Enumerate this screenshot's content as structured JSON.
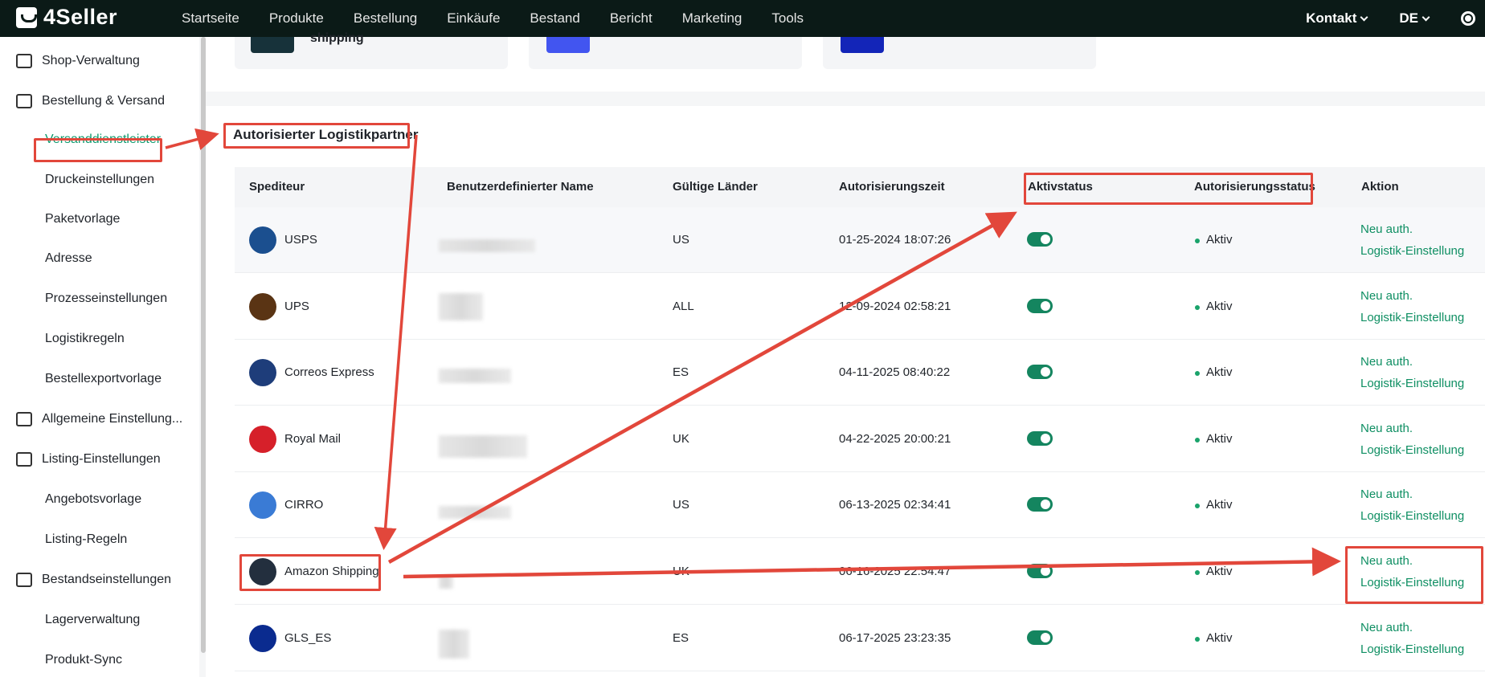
{
  "brand": {
    "name": "4Seller"
  },
  "nav": [
    "Startseite",
    "Produkte",
    "Bestellung",
    "Einkäufe",
    "Bestand",
    "Bericht",
    "Marketing",
    "Tools"
  ],
  "header_right": {
    "contact": "Kontakt",
    "language": "DE"
  },
  "sidebar": {
    "items": [
      {
        "label": "Shop-Verwaltung",
        "level": "top"
      },
      {
        "label": "Bestellung & Versand",
        "level": "top"
      },
      {
        "label": "Versanddienstleister",
        "level": "sub",
        "active": true
      },
      {
        "label": "Druckeinstellungen",
        "level": "sub"
      },
      {
        "label": "Paketvorlage",
        "level": "sub"
      },
      {
        "label": "Adresse",
        "level": "sub"
      },
      {
        "label": "Prozesseinstellungen",
        "level": "sub"
      },
      {
        "label": "Logistikregeln",
        "level": "sub"
      },
      {
        "label": "Bestellexportvorlage",
        "level": "sub"
      },
      {
        "label": "Allgemeine Einstellung...",
        "level": "top"
      },
      {
        "label": "Listing-Einstellungen",
        "level": "top"
      },
      {
        "label": "Angebotsvorlage",
        "level": "sub"
      },
      {
        "label": "Listing-Regeln",
        "level": "sub"
      },
      {
        "label": "Bestandseinstellungen",
        "level": "top"
      },
      {
        "label": "Lagerverwaltung",
        "level": "sub"
      },
      {
        "label": "Produkt-Sync",
        "level": "sub"
      }
    ]
  },
  "top_cards": [
    {
      "text": "shipping"
    }
  ],
  "section": {
    "title": "Autorisierter Logistikpartner"
  },
  "table": {
    "headers": [
      "Spediteur",
      "Benutzerdefinierter Name",
      "Gültige Länder",
      "Autorisierungszeit",
      "Aktivstatus",
      "Autorisierungsstatus",
      "Aktion"
    ],
    "rows": [
      {
        "carrier": "USPS",
        "country": "US",
        "time": "01-25-2024 18:07:26",
        "status": "Aktiv",
        "logo_color": "#1b4f8f"
      },
      {
        "carrier": "UPS",
        "country": "ALL",
        "time": "12-09-2024 02:58:21",
        "status": "Aktiv",
        "logo_color": "#5a3414"
      },
      {
        "carrier": "Correos Express",
        "country": "ES",
        "time": "04-11-2025 08:40:22",
        "status": "Aktiv",
        "logo_color": "#1e3d7a"
      },
      {
        "carrier": "Royal Mail",
        "country": "UK",
        "time": "04-22-2025 20:00:21",
        "status": "Aktiv",
        "logo_color": "#d6202a"
      },
      {
        "carrier": "CIRRO",
        "country": "US",
        "time": "06-13-2025 02:34:41",
        "status": "Aktiv",
        "logo_color": "#3a7bd5"
      },
      {
        "carrier": "Amazon Shipping",
        "country": "UK",
        "time": "06-16-2025 22:54:47",
        "status": "Aktiv",
        "logo_color": "#232f3e"
      },
      {
        "carrier": "GLS_ES",
        "country": "ES",
        "time": "06-17-2025 23:23:35",
        "status": "Aktiv",
        "logo_color": "#0a2b8f"
      }
    ],
    "action_reauth": "Neu auth.",
    "action_settings": "Logistik-Einstellung"
  },
  "colors": {
    "accent": "#14855f",
    "annotation": "#e2473b",
    "topbar": "#0b1a17"
  }
}
